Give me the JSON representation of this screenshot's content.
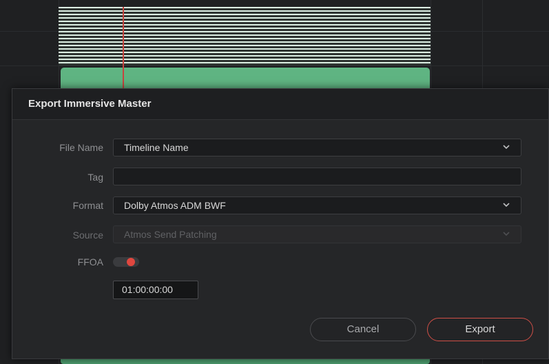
{
  "dialog": {
    "title": "Export Immersive Master",
    "fields": {
      "file_name": {
        "label": "File Name",
        "value": "Timeline Name"
      },
      "tag": {
        "label": "Tag",
        "value": ""
      },
      "format": {
        "label": "Format",
        "value": "Dolby Atmos ADM BWF"
      },
      "source": {
        "label": "Source",
        "value": "Atmos Send Patching",
        "disabled": true
      },
      "ffoa": {
        "label": "FFOA",
        "toggle_on": true,
        "timecode": "01:00:00:00"
      }
    },
    "buttons": {
      "cancel": "Cancel",
      "export": "Export"
    }
  },
  "colors": {
    "accent": "#e0473f",
    "clip_green": "#5fb482",
    "dialog_bg": "#252628"
  },
  "icons": [
    "chevron-down-icon"
  ]
}
